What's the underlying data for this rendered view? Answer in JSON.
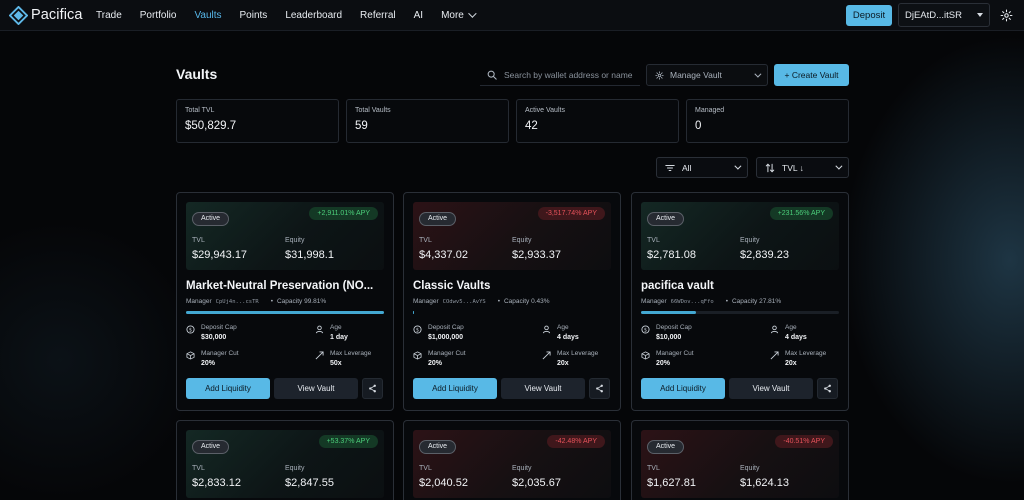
{
  "app": {
    "name": "Pacifica"
  },
  "nav": {
    "links": [
      "Trade",
      "Portfolio",
      "Vaults",
      "Points",
      "Leaderboard",
      "Referral",
      "AI",
      "More"
    ],
    "active": "Vaults",
    "deposit_label": "Deposit",
    "wallet": "DjEAtD...itSR"
  },
  "page": {
    "title": "Vaults",
    "search_placeholder": "Search by wallet address or name",
    "manage_label": "Manage Vault",
    "create_label": "+ Create Vault"
  },
  "stats": [
    {
      "label": "Total TVL",
      "value": "$50,829.7"
    },
    {
      "label": "Total Vaults",
      "value": "59"
    },
    {
      "label": "Active Vaults",
      "value": "42"
    },
    {
      "label": "Managed",
      "value": "0"
    }
  ],
  "filters": {
    "status": "All",
    "sort": "TVL ↓"
  },
  "labels": {
    "tvl": "TVL",
    "equity": "Equity",
    "manager": "Manager",
    "capacity_prefix": "Capacity",
    "deposit_cap": "Deposit Cap",
    "age": "Age",
    "manager_cut": "Manager Cut",
    "max_leverage": "Max Leverage",
    "add_liquidity": "Add Liquidity",
    "view_vault": "View Vault"
  },
  "vaults": [
    {
      "status": "Active",
      "apy": "+2,911.01% APY",
      "apy_positive": true,
      "tvl": "$29,943.17",
      "equity": "$31,998.1",
      "name": "Market-Neutral Preservation (NO...",
      "manager": "CpUj4n...csTR",
      "capacity": "Capacity 99.81%",
      "capacity_fraction": 0.9981,
      "deposit_cap": "$30,000",
      "age": "1 day",
      "manager_cut": "20%",
      "max_leverage": "50x"
    },
    {
      "status": "Active",
      "apy": "-3,517.74% APY",
      "apy_positive": false,
      "tvl": "$4,337.02",
      "equity": "$2,933.37",
      "name": "Classic Vaults",
      "manager": "COdwv5...AvYS",
      "capacity": "Capacity 0.43%",
      "capacity_fraction": 0.0043,
      "deposit_cap": "$1,000,000",
      "age": "4 days",
      "manager_cut": "20%",
      "max_leverage": "20x"
    },
    {
      "status": "Active",
      "apy": "+231.56% APY",
      "apy_positive": true,
      "tvl": "$2,781.08",
      "equity": "$2,839.23",
      "name": "pacifica vault",
      "manager": "66WDov...qFfo",
      "capacity": "Capacity 27.81%",
      "capacity_fraction": 0.2781,
      "deposit_cap": "$10,000",
      "age": "4 days",
      "manager_cut": "20%",
      "max_leverage": "20x"
    },
    {
      "status": "Active",
      "apy": "+53.37% APY",
      "apy_positive": true,
      "tvl": "$2,833.12",
      "equity": "$2,847.55"
    },
    {
      "status": "Active",
      "apy": "-42.48% APY",
      "apy_positive": false,
      "tvl": "$2,040.52",
      "equity": "$2,035.67"
    },
    {
      "status": "Active",
      "apy": "-40.51% APY",
      "apy_positive": false,
      "tvl": "$1,627.81",
      "equity": "$1,624.13"
    }
  ],
  "colors": {
    "accent": "#58b9e6",
    "positive": "#4ccf7b",
    "negative": "#e6525a",
    "background": "#050608"
  }
}
